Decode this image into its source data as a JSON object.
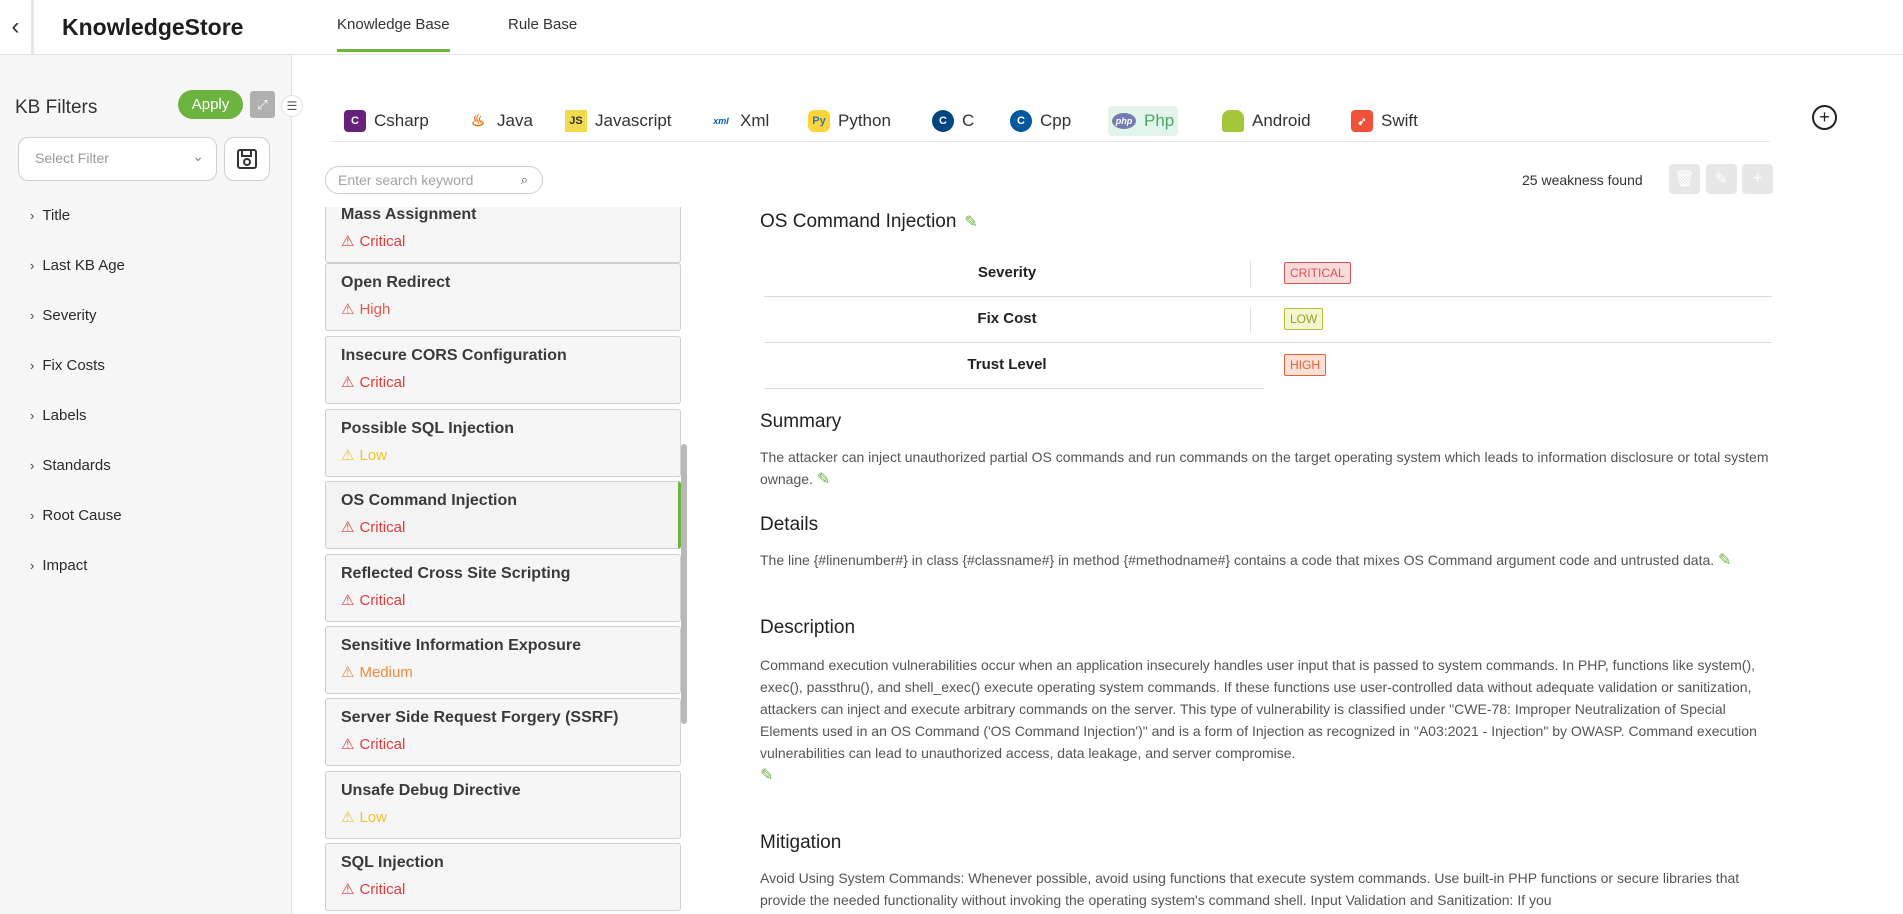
{
  "app": {
    "title": "KnowledgeStore"
  },
  "top_tabs": [
    {
      "label": "Knowledge Base",
      "active": true
    },
    {
      "label": "Rule Base",
      "active": false
    }
  ],
  "sidebar": {
    "title": "KB Filters",
    "apply_label": "Apply",
    "select_placeholder": "Select Filter",
    "filters": [
      "Title",
      "Last KB Age",
      "Severity",
      "Fix Costs",
      "Labels",
      "Standards",
      "Root Cause",
      "Impact"
    ]
  },
  "languages": [
    {
      "label": "Csharp",
      "icon": "csharp-icon",
      "color": "#68217a"
    },
    {
      "label": "Java",
      "icon": "java-icon",
      "color": "#e76f00"
    },
    {
      "label": "Javascript",
      "icon": "javascript-icon",
      "color": "#f0db4f"
    },
    {
      "label": "Xml",
      "icon": "xml-icon",
      "color": "#0060ac"
    },
    {
      "label": "Python",
      "icon": "python-icon",
      "color": "#ffd43b"
    },
    {
      "label": "C",
      "icon": "c-icon",
      "color": "#004482"
    },
    {
      "label": "Cpp",
      "icon": "cpp-icon",
      "color": "#00599c"
    },
    {
      "label": "Php",
      "icon": "php-icon",
      "color": "#777bb3",
      "active": true
    },
    {
      "label": "Android",
      "icon": "android-icon",
      "color": "#a4c639"
    },
    {
      "label": "Swift",
      "icon": "swift-icon",
      "color": "#f05138"
    }
  ],
  "search": {
    "placeholder": "Enter search keyword"
  },
  "weakness_count": "25 weakness found",
  "weaknesses": [
    {
      "name": "Mass Assignment",
      "severity": "Critical"
    },
    {
      "name": "Open Redirect",
      "severity": "High"
    },
    {
      "name": "Insecure CORS Configuration",
      "severity": "Critical"
    },
    {
      "name": "Possible SQL Injection",
      "severity": "Low"
    },
    {
      "name": "OS Command Injection",
      "severity": "Critical",
      "active": true
    },
    {
      "name": "Reflected Cross Site Scripting",
      "severity": "Critical"
    },
    {
      "name": "Sensitive Information Exposure",
      "severity": "Medium"
    },
    {
      "name": "Server Side Request Forgery (SSRF)",
      "severity": "Critical"
    },
    {
      "name": "Unsafe Debug Directive",
      "severity": "Low"
    },
    {
      "name": "SQL Injection",
      "severity": "Critical"
    }
  ],
  "severity_colors": {
    "Critical": "#e03c3c",
    "High": "#e8584a",
    "Medium": "#ee8a3c",
    "Low": "#f2c230"
  },
  "detail": {
    "title": "OS Command Injection",
    "attributes": [
      {
        "label": "Severity",
        "value": "CRITICAL",
        "color": "#d9534f",
        "bg": "#fbdada"
      },
      {
        "label": "Fix Cost",
        "value": "LOW",
        "color": "#9aa028",
        "bg": "#f4f6cf"
      },
      {
        "label": "Trust Level",
        "value": "HIGH",
        "color": "#e0603a",
        "bg": "#fbe0d6"
      }
    ],
    "summary_head": "Summary",
    "summary": "The attacker can inject unauthorized partial OS commands and run commands on the target operating system which leads to information disclosure or total system ownage.",
    "details_head": "Details",
    "details": "The line {#linenumber#} in class {#classname#} in method {#methodname#} contains a code that mixes OS Command argument code and untrusted data.",
    "description_head": "Description",
    "description": "Command execution vulnerabilities occur when an application insecurely handles user input that is passed to system commands. In PHP, functions like system(), exec(), passthru(), and shell_exec() execute operating system commands. If these functions use user-controlled data without adequate validation or sanitization, attackers can inject and execute arbitrary commands on the server. This type of vulnerability is classified under \"CWE-78: Improper Neutralization of Special Elements used in an OS Command ('OS Command Injection')\" and is a form of Injection as recognized in \"A03:2021 - Injection\" by OWASP. Command execution vulnerabilities can lead to unauthorized access, data leakage, and server compromise.",
    "mitigation_head": "Mitigation",
    "mitigation": "Avoid Using System Commands: Whenever possible, avoid using functions that execute system commands. Use built-in PHP functions or secure libraries that provide the needed functionality without invoking the operating system's command shell. Input Validation and Sanitization: If you"
  }
}
